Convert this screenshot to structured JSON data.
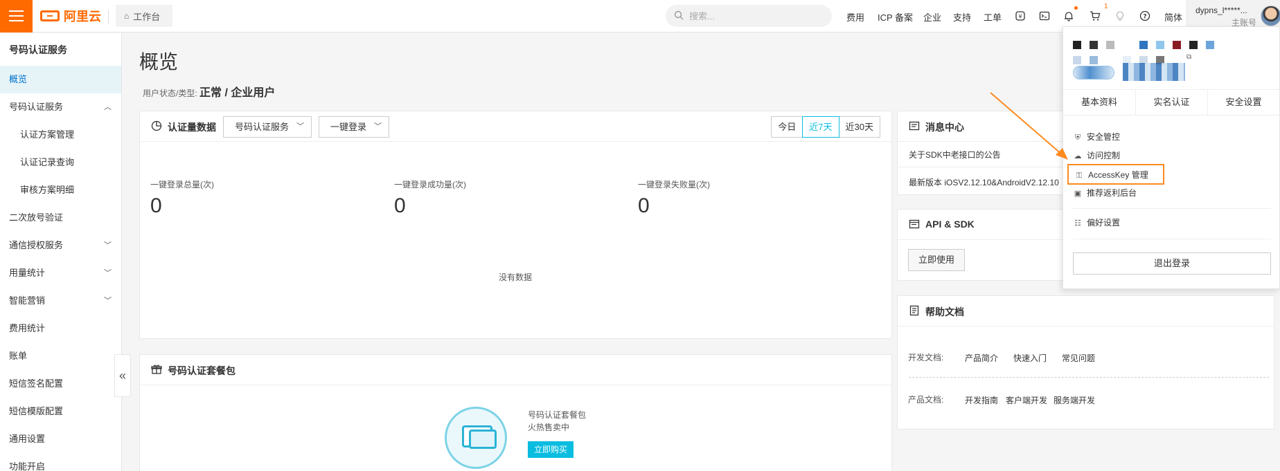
{
  "topbar": {
    "logo_text": "阿里云",
    "workbench": "工作台",
    "search_placeholder": "搜索...",
    "nav": [
      "费用",
      "ICP 备案",
      "企业",
      "支持",
      "工单"
    ],
    "cart_badge": "1",
    "lang": "简体",
    "user_name": "dypns_l*****...",
    "user_role": "主账号"
  },
  "sidebar": {
    "title": "号码认证服务",
    "items": [
      {
        "label": "概览"
      },
      {
        "label": "号码认证服务"
      },
      {
        "label": "认证方案管理"
      },
      {
        "label": "认证记录查询"
      },
      {
        "label": "审核方案明细"
      },
      {
        "label": "二次放号验证"
      },
      {
        "label": "通信授权服务"
      },
      {
        "label": "用量统计"
      },
      {
        "label": "智能营销"
      },
      {
        "label": "费用统计"
      },
      {
        "label": "账单"
      },
      {
        "label": "短信签名配置"
      },
      {
        "label": "短信模版配置"
      },
      {
        "label": "通用设置"
      },
      {
        "label": "功能开启"
      }
    ]
  },
  "main": {
    "title": "概览",
    "status_label": "用户状态/类型:",
    "status_value": "正常 / 企业用户",
    "auth_card": {
      "title": "认证量数据",
      "select1": "号码认证服务",
      "select2": "一键登录",
      "ranges": [
        "今日",
        "近7天",
        "近30天"
      ],
      "metrics": [
        {
          "label": "一键登录总量(次)",
          "value": "0"
        },
        {
          "label": "一键登录成功量(次)",
          "value": "0"
        },
        {
          "label": "一键登录失败量(次)",
          "value": "0"
        }
      ],
      "empty": "没有数据"
    },
    "package_card": {
      "title": "号码认证套餐包",
      "name": "号码认证套餐包",
      "sub": "火热售卖中",
      "buy": "立即购买"
    },
    "message_card": {
      "title": "消息中心",
      "rows": [
        "关于SDK中老接口的公告",
        "最新版本 iOSV2.12.10&AndroidV2.12.10"
      ]
    },
    "api_card": {
      "title": "API & SDK",
      "button": "立即使用"
    },
    "help_card": {
      "title": "帮助文档",
      "dev_label": "开发文档:",
      "dev_links": [
        "产品简介",
        "快速入门",
        "常见问题"
      ],
      "product_label": "产品文档:",
      "product_links": [
        "开发指南",
        "客户端开发",
        "服务端开发"
      ]
    }
  },
  "dropdown": {
    "tabs": [
      "基本资料",
      "实名认证",
      "安全设置"
    ],
    "items": [
      "安全管控",
      "访问控制",
      "AccessKey 管理",
      "推荐返利后台",
      "偏好设置"
    ],
    "logout": "退出登录"
  },
  "colors": {
    "brand": "#ff6a00",
    "accent": "#0abde0",
    "highlight_border": "#ff8a1f"
  }
}
